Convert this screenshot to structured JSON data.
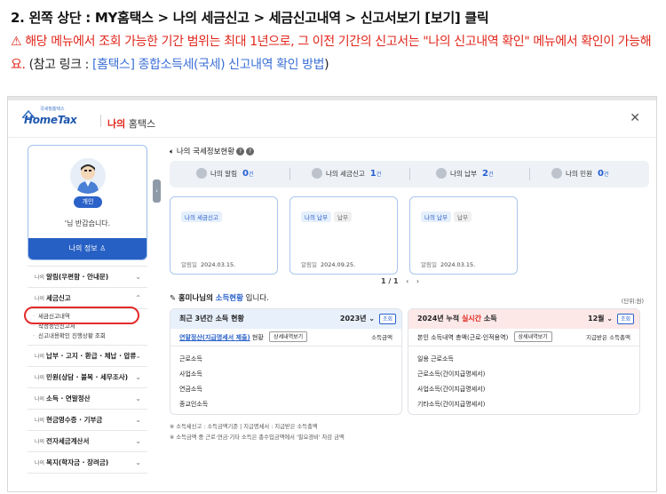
{
  "article": {
    "heading": "2. 왼쪽 상단 : MY홈택스 > 나의 세금신고 > 세금신고내역 > 신고서보기 [보기] 클릭",
    "warning_line": "⚠ 해당 메뉴에서 조회 가능한 기간 범위는 최대 1년으로, 그 이전 기간의 신고서는 \"나의 신고내역 확인\" 메뉴에서 확인이 가능해요.",
    "ref_prefix": " (참고 링크 : ",
    "ref_link": "[홈택스] 종합소득세(국세) 신고내역 확인 방법",
    "ref_suffix": ")"
  },
  "header": {
    "logo_small": "국세청홈택스",
    "logo_text": "HomeTax",
    "my_prefix": "나의",
    "my_suffix": "홈택스",
    "close": "✕"
  },
  "profile": {
    "badge": "개인",
    "greeting": "'님 반갑습니다.",
    "my_info_button": "나의 정보 ♙"
  },
  "menu": {
    "items_top": [
      {
        "pre": "나의",
        "label": "알림(우편함 · 안내문)",
        "chev": "⌄"
      },
      {
        "pre": "나의",
        "label": "세금신고",
        "chev": "⌃"
      }
    ],
    "sub_items": [
      "세금신고내역",
      "작성중인신고서",
      "신고내용확인 진행상황 조회"
    ],
    "items_bottom": [
      {
        "pre": "나의",
        "label": "납부 · 고지 · 환급 · 체납 · 압류",
        "chev": "⌄"
      },
      {
        "pre": "나의",
        "label": "민원(상담 · 불복 · 세무조사)",
        "chev": "⌄"
      },
      {
        "pre": "나의",
        "label": "소득 · 연말정산",
        "chev": "⌄"
      },
      {
        "pre": "나의",
        "label": "현금영수증 · 기부금",
        "chev": "⌄"
      },
      {
        "pre": "나의",
        "label": "전자세금계산서",
        "chev": "⌄"
      },
      {
        "pre": "나의",
        "label": "복지(학자금 · 장려금)",
        "chev": "⌄"
      }
    ]
  },
  "status": {
    "title_prefix": "나의 국세정보현황",
    "help": "?",
    "items": [
      {
        "label": "나의 알림",
        "num": "0",
        "unit": "건"
      },
      {
        "label": "나의 세금신고",
        "num": "1",
        "unit": "건"
      },
      {
        "label": "나의 납부",
        "num": "2",
        "unit": "건"
      },
      {
        "label": "나의 민원",
        "num": "0",
        "unit": "건"
      }
    ]
  },
  "cards": [
    {
      "tags": [
        "나의 세금신고"
      ],
      "date_label": "알림일",
      "date": "2024.03.15."
    },
    {
      "tags": [
        "나의 납부",
        "납부"
      ],
      "date_label": "알림일",
      "date": "2024.09.25."
    },
    {
      "tags": [
        "나의 납부",
        "납부"
      ],
      "date_label": "알림일",
      "date": "2024.03.15."
    }
  ],
  "pager": {
    "text": "1 / 1",
    "prev": "‹",
    "next": "›"
  },
  "income": {
    "title_prefix": "홍미나님의",
    "title_hl": "소득현황",
    "title_suffix": "입니다.",
    "unit": "(단위:원)",
    "left": {
      "head": "최근 3년간 소득 현황",
      "year": "2023년 ⌄",
      "query": "조회",
      "sub_hl": "연말정산(지급명세서 제출)",
      "sub_rest": "현황",
      "detail": "상세내역보기",
      "col": "소득금액",
      "rows": [
        "근로소득",
        "사업소득",
        "연금소득",
        "종교인소득"
      ]
    },
    "right": {
      "head_prefix": "2024년 누적",
      "head_red": "실시간",
      "head_suffix": "소득",
      "month": "12월 ⌄",
      "query": "조회",
      "sub": "본인 소득내역 총액(근로·인적용역)",
      "detail": "상세내역보기",
      "col": "지급받은 소득총액",
      "rows": [
        "일용 근로소득",
        "근로소득(간이지급명세서)",
        "사업소득(간이지급명세서)",
        "기타소득(간이지급명세서)"
      ]
    },
    "notes": [
      "※ 소득세신고 : 소득금액기준  |  지급명세서 : 지급받은 소득총액",
      "※ 소득금액 중 근로·연금·기타 소득은 총수입금액에서 '필요경비' 차감 금액"
    ]
  }
}
